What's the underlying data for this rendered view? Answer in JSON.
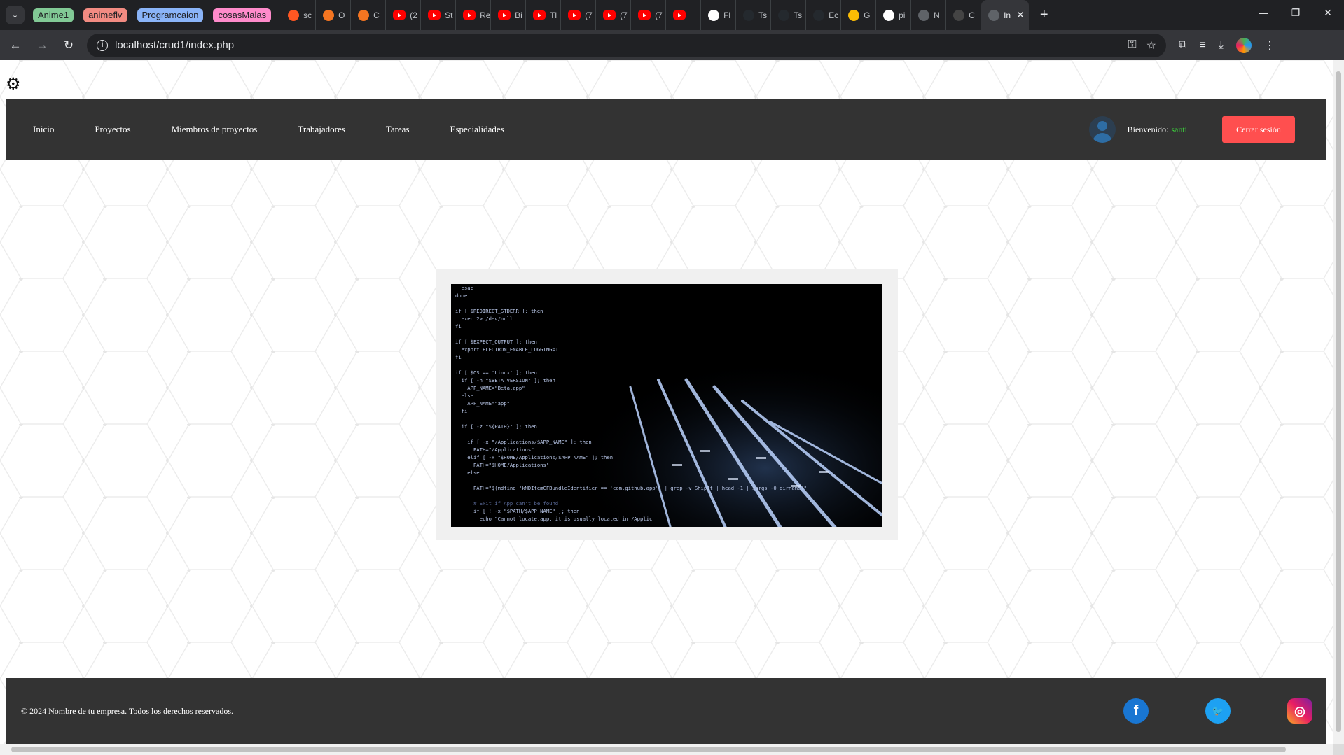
{
  "browser": {
    "tab_groups": [
      {
        "label": "Anime1",
        "color": "#81c995"
      },
      {
        "label": "animeflv",
        "color": "#f28b82"
      },
      {
        "label": "Programcaion",
        "color": "#8ab4f8"
      },
      {
        "label": "cosasMalas",
        "color": "#ff8bcb"
      }
    ],
    "tabs": [
      {
        "title": "sc",
        "icon": "w-icon"
      },
      {
        "title": "O",
        "icon": "crunchy-icon"
      },
      {
        "title": "C",
        "icon": "crunchy-icon"
      },
      {
        "title": "(2",
        "icon": "youtube-icon"
      },
      {
        "title": "St",
        "icon": "youtube-icon"
      },
      {
        "title": "Re",
        "icon": "youtube-icon"
      },
      {
        "title": "Bi",
        "icon": "youtube-icon"
      },
      {
        "title": "Tl",
        "icon": "youtube-icon"
      },
      {
        "title": "(7",
        "icon": "youtube-icon"
      },
      {
        "title": "(7",
        "icon": "youtube-icon"
      },
      {
        "title": "(7",
        "icon": "youtube-icon"
      },
      {
        "title": "",
        "icon": "youtube-icon"
      },
      {
        "title": "Fl",
        "icon": "google-icon"
      },
      {
        "title": "Ts",
        "icon": "github-icon"
      },
      {
        "title": "Ts",
        "icon": "github-icon"
      },
      {
        "title": "Ec",
        "icon": "github-icon"
      },
      {
        "title": "G",
        "icon": "keep-icon"
      },
      {
        "title": "pi",
        "icon": "google-icon"
      },
      {
        "title": "N",
        "icon": "chrome-icon"
      },
      {
        "title": "C",
        "icon": "openai-icon"
      }
    ],
    "active_tab": {
      "title": "In"
    },
    "url": "localhost/crud1/index.php"
  },
  "nav": {
    "links": [
      "Inicio",
      "Proyectos",
      "Miembros de proyectos",
      "Trabajadores",
      "Tareas",
      "Especialidades"
    ],
    "welcome": "Bienvenido:",
    "username": "santi",
    "logout": "Cerrar sesión"
  },
  "hero": {
    "code_lines": [
      "  esac",
      "done",
      "",
      "if [ $REDIRECT_STDERR ]; then",
      "  exec 2> /dev/null",
      "fi",
      "",
      "if [ $EXPECT_OUTPUT ]; then",
      "  export ELECTRON_ENABLE_LOGGING=1",
      "fi",
      "",
      "if [ $OS == 'Linux' ]; then",
      "  if [ -n \"$BETA_VERSION\" ]; then",
      "    APP_NAME=\"Beta.app\"",
      "  else",
      "    APP_NAME=\"app\"",
      "  fi",
      "",
      "  if [ -z \"${PATH}\" ]; then",
      "",
      "    if [ -x \"/Applications/$APP_NAME\" ]; then",
      "      PATH=\"/Applications\"",
      "    elif [ -x \"$HOME/Applications/$APP_NAME\" ]; then",
      "      PATH=\"$HOME/Applications\"",
      "    else",
      "",
      "      PATH=\"$(mdfind \"kMDItemCFBundleIdentifier == 'com.github.app'\" | grep -v ShipIt | head -1 | xargs -0 dirname)\"",
      "",
      "      # Exit if App can't be found",
      "      if [ ! -x \"$PATH/$APP_NAME\" ]; then",
      "        echo \"Cannot locate.app, it is usually located in /Applic"
    ]
  },
  "footer": {
    "copyright": "© 2024 Nombre de tu empresa. Todos los derechos reservados.",
    "social": [
      {
        "icon": "facebook-icon",
        "glyph": "f"
      },
      {
        "icon": "twitter-icon",
        "glyph": "🐦"
      },
      {
        "icon": "instagram-icon",
        "glyph": "◎"
      }
    ]
  },
  "colors": {
    "navbar_bg": "#333333",
    "logout_bg": "#ff4f4f",
    "username": "#3cdc3c"
  }
}
